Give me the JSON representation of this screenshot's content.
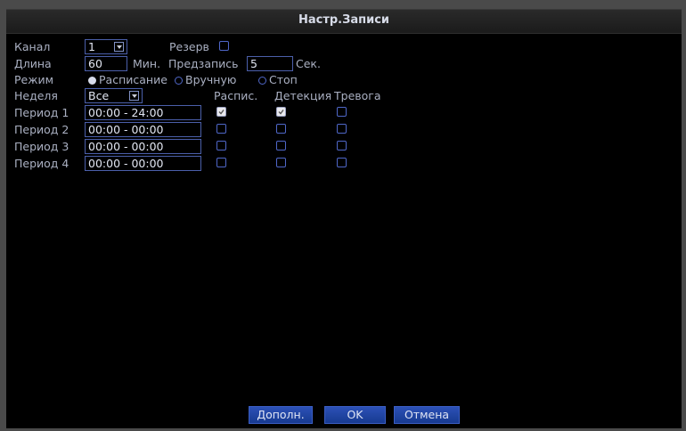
{
  "window": {
    "title": "Настр.Записи"
  },
  "channel": {
    "label": "Канал",
    "value": "1"
  },
  "backup": {
    "label": "Резерв",
    "checked": false
  },
  "length": {
    "label": "Длина",
    "value": "60",
    "unit": "Мин."
  },
  "prerecord": {
    "label": "Предзапись",
    "value": "5",
    "unit": "Сек."
  },
  "mode": {
    "label": "Режим",
    "options": [
      {
        "label": "Расписание",
        "selected": true
      },
      {
        "label": "Вручную",
        "selected": false
      },
      {
        "label": "Стоп",
        "selected": false
      }
    ]
  },
  "week": {
    "label": "Неделя",
    "value": "Все"
  },
  "columns": {
    "schedule": "Распис.",
    "detection": "Детекция",
    "alarm": "Тревога"
  },
  "periods": [
    {
      "label": "Период 1",
      "time": "00:00  -  24:00",
      "schedule": true,
      "detection": true,
      "alarm": false
    },
    {
      "label": "Период 2",
      "time": "00:00  -  00:00",
      "schedule": false,
      "detection": false,
      "alarm": false
    },
    {
      "label": "Период 3",
      "time": "00:00  -  00:00",
      "schedule": false,
      "detection": false,
      "alarm": false
    },
    {
      "label": "Период 4",
      "time": "00:00  -  00:00",
      "schedule": false,
      "detection": false,
      "alarm": false
    }
  ],
  "buttons": {
    "advanced": "Дополн.",
    "ok": "OK",
    "cancel": "Отмена"
  },
  "colors": {
    "background": "#000000",
    "accent": "#1f46a8",
    "text": "#aab0c2"
  }
}
